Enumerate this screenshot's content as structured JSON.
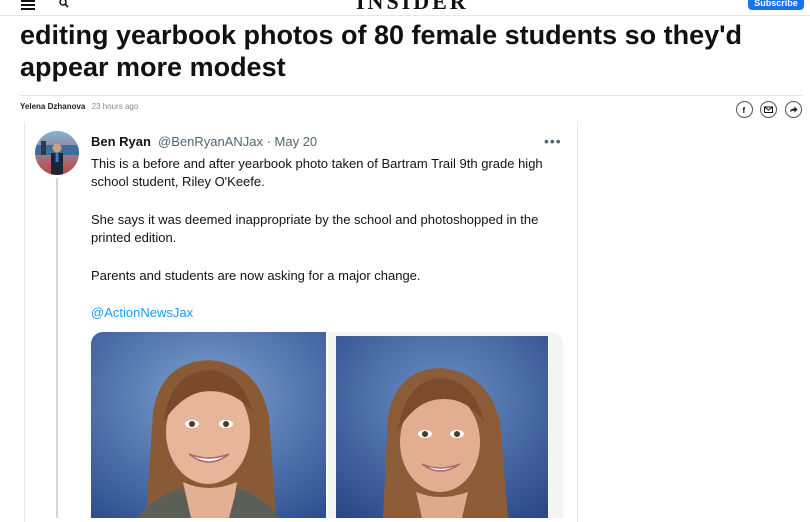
{
  "header": {
    "logo": "INSIDER",
    "subscribe_label": "Subscribe"
  },
  "article": {
    "headline": "editing yearbook photos of 80 female students so they'd appear more modest",
    "author": "Yelena Dzhanova",
    "time_ago": "23 hours ago"
  },
  "share_icons": [
    "facebook-icon",
    "email-icon",
    "share-icon"
  ],
  "tweet": {
    "display_name": "Ben Ryan",
    "handle_date": "@BenRyanANJax · May 20",
    "more": "•••",
    "paragraph_1": "This is a before and after yearbook photo taken of Bartram Trail 9th grade high school student, Riley O'Keefe.",
    "paragraph_2": "She says it was deemed inappropriate by the school and photoshopped in the printed edition.",
    "paragraph_3": "Parents and students are now asking for a major change.",
    "mention": "@ActionNewsJax"
  },
  "colors": {
    "subscribe_bg": "#1a73e8",
    "link": "#1d9bf0",
    "photo_bg": "#3d5f9c"
  }
}
